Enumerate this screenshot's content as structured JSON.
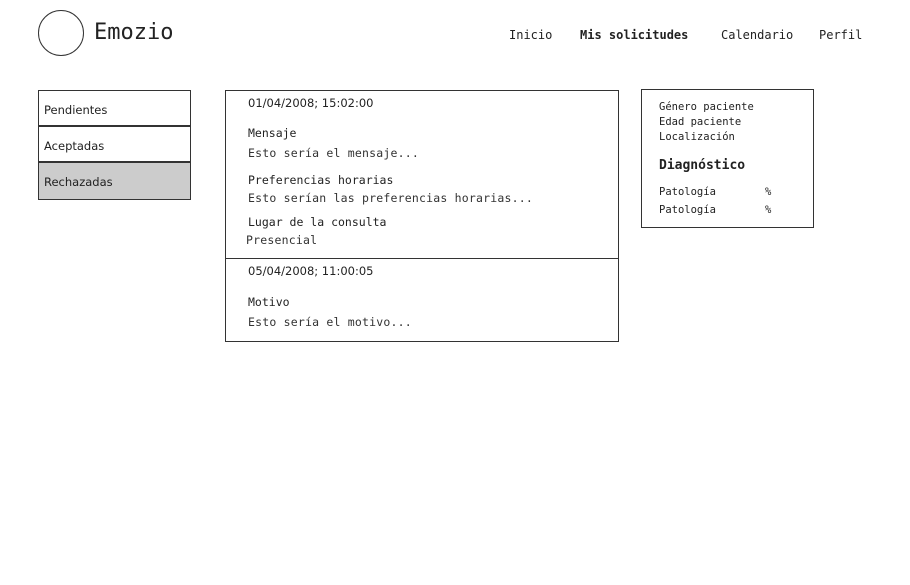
{
  "header": {
    "logo_text": "Emozio",
    "nav": [
      {
        "label": "Inicio"
      },
      {
        "label": "Mis solicitudes"
      },
      {
        "label": "Calendario"
      },
      {
        "label": "Perfil"
      }
    ]
  },
  "tabs": [
    {
      "label": "Pendientes"
    },
    {
      "label": "Aceptadas"
    },
    {
      "label": "Rechazadas"
    }
  ],
  "requests": [
    {
      "timestamp": "01/04/2008; 15:02:00",
      "fields": [
        {
          "label": "Mensaje",
          "value": "Esto sería el mensaje..."
        },
        {
          "label": "Preferencias horarias",
          "value": "Esto serían las preferencias horarias..."
        },
        {
          "label": "Lugar de la consulta",
          "value": "Presencial"
        }
      ]
    },
    {
      "timestamp": "05/04/2008; 11:00:05",
      "fields": [
        {
          "label": "Motivo",
          "value": "Esto sería el motivo..."
        }
      ]
    }
  ],
  "patient": {
    "gender": "Género paciente",
    "age": "Edad paciente",
    "location": "Localización",
    "diagnosis_title": "Diagnóstico",
    "pathologies": [
      {
        "name": "Patología",
        "pct": "%"
      },
      {
        "name": "Patología",
        "pct": "%"
      }
    ]
  }
}
